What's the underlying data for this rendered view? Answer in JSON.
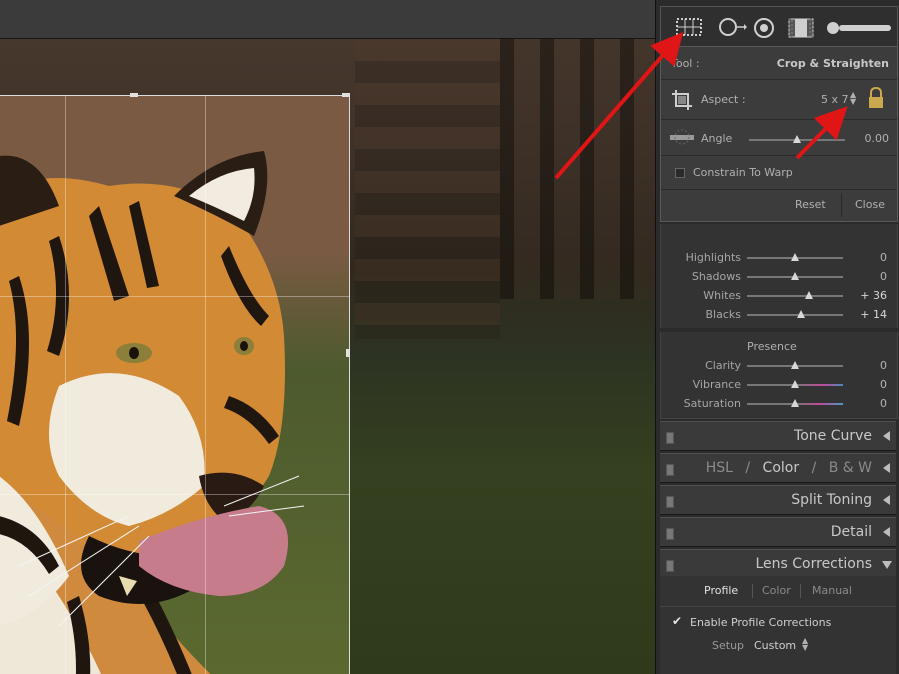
{
  "crop_panel": {
    "tool_label": "Tool :",
    "tool_name": "Crop & Straighten",
    "aspect_label": "Aspect :",
    "aspect_value": "5 x 7",
    "angle_label": "Angle",
    "angle_value": "0.00",
    "constrain_label": "Constrain To Warp",
    "reset_label": "Reset",
    "close_label": "Close"
  },
  "tone": {
    "rows": [
      {
        "label": "Highlights",
        "value": "0",
        "level": 0.5
      },
      {
        "label": "Shadows",
        "value": "0",
        "level": 0.5
      },
      {
        "label": "Whites",
        "value": "+ 36",
        "level": 0.65
      },
      {
        "label": "Blacks",
        "value": "+ 14",
        "level": 0.56
      }
    ]
  },
  "presence": {
    "title": "Presence",
    "rows": [
      {
        "label": "Clarity",
        "value": "0",
        "level": 0.5
      },
      {
        "label": "Vibrance",
        "value": "0",
        "level": 0.5
      },
      {
        "label": "Saturation",
        "value": "0",
        "level": 0.5
      }
    ]
  },
  "sections": {
    "tone_curve": "Tone Curve",
    "hsl": "HSL",
    "color": "Color",
    "bw": "B & W",
    "slash": "/",
    "split_toning": "Split Toning",
    "detail": "Detail",
    "lens_corrections": "Lens Corrections"
  },
  "lens": {
    "tabs": [
      "Profile",
      "Color",
      "Manual"
    ],
    "enable_label": "Enable Profile Corrections",
    "setup_label": "Setup",
    "setup_value": "Custom"
  },
  "colors": {
    "arrow": "#e01515",
    "panel_bg": "#2b2b2b"
  }
}
